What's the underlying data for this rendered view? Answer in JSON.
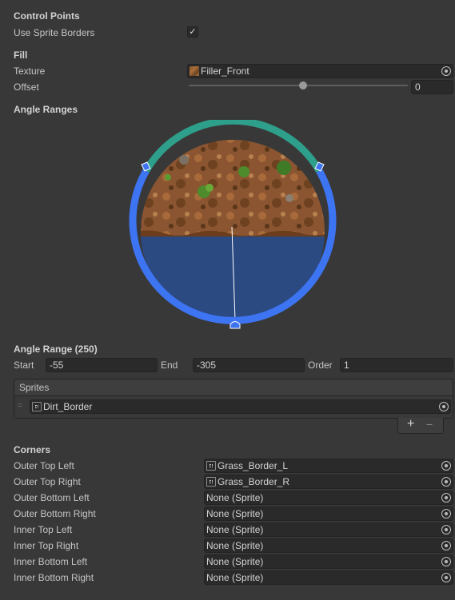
{
  "control_points": {
    "header": "Control Points",
    "use_sprite_borders_label": "Use Sprite Borders",
    "use_sprite_borders_checked": true,
    "check_glyph": "✓"
  },
  "fill": {
    "header": "Fill",
    "texture_label": "Texture",
    "texture_value": "Filler_Front",
    "offset_label": "Offset",
    "offset_value": "0",
    "offset_slider_fraction": 0.5
  },
  "angle_ranges": {
    "header": "Angle Ranges",
    "range_title": "Angle Range (250)",
    "start_label": "Start",
    "start_value": "-55",
    "end_label": "End",
    "end_value": "-305",
    "order_label": "Order",
    "order_value": "1",
    "colors": {
      "active_range": "#3d74f2",
      "other_range": "#2e9f8a",
      "fill_area": "#2a4a80"
    }
  },
  "sprites": {
    "header": "Sprites",
    "items": [
      "Dirt_Border"
    ],
    "add_glyph": "+",
    "remove_glyph": "−",
    "drag_handle_glyph": "="
  },
  "corners": {
    "header": "Corners",
    "rows": [
      {
        "label": "Outer Top Left",
        "value": "Grass_Border_L",
        "has_icon": true
      },
      {
        "label": "Outer Top Right",
        "value": "Grass_Border_R",
        "has_icon": true
      },
      {
        "label": "Outer Bottom Left",
        "value": "None (Sprite)",
        "has_icon": false
      },
      {
        "label": "Outer Bottom Right",
        "value": "None (Sprite)",
        "has_icon": false
      },
      {
        "label": "Inner Top Left",
        "value": "None (Sprite)",
        "has_icon": false
      },
      {
        "label": "Inner Top Right",
        "value": "None (Sprite)",
        "has_icon": false
      },
      {
        "label": "Inner Bottom Left",
        "value": "None (Sprite)",
        "has_icon": false
      },
      {
        "label": "Inner Bottom Right",
        "value": "None (Sprite)",
        "has_icon": false
      }
    ]
  }
}
